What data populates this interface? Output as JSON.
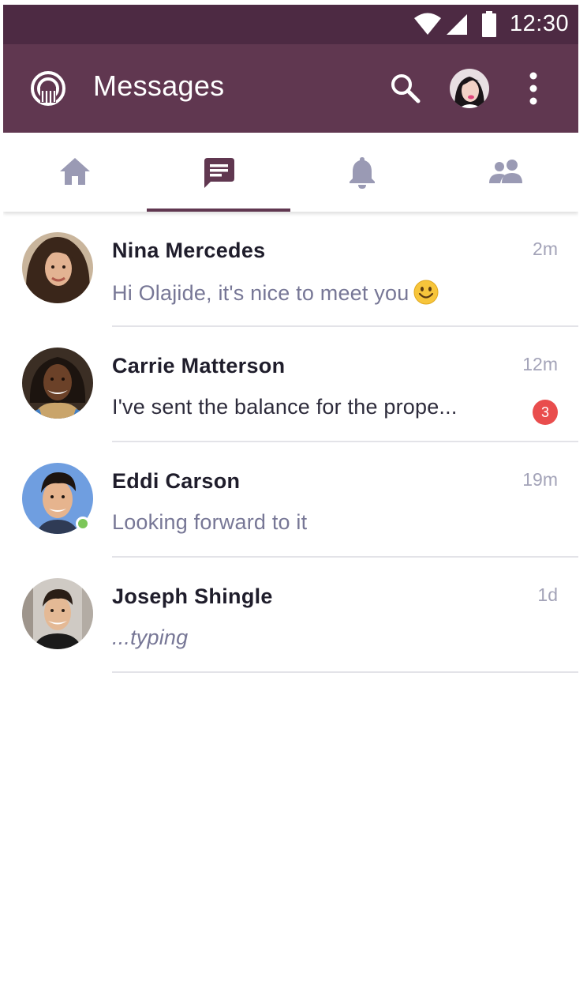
{
  "status_bar": {
    "time": "12:30",
    "icons": [
      "wifi-icon",
      "signal-icon",
      "battery-icon"
    ]
  },
  "app_bar": {
    "title": "Messages",
    "icons": [
      "app-logo",
      "search-icon",
      "profile-avatar",
      "more-vert-icon"
    ]
  },
  "tabs": [
    {
      "name": "home",
      "icon": "home-icon",
      "active": false
    },
    {
      "name": "messages",
      "icon": "chat-icon",
      "active": true
    },
    {
      "name": "notifications",
      "icon": "bell-icon",
      "active": false
    },
    {
      "name": "contacts",
      "icon": "people-icon",
      "active": false
    }
  ],
  "conversations": [
    {
      "name": "Nina Mercedes",
      "time": "2m",
      "preview": "Hi Olajide, it's nice to meet you",
      "emoji": "smiling-face",
      "online": false,
      "unread": null
    },
    {
      "name": "Carrie Matterson",
      "time": "12m",
      "preview": "I've sent the balance for  the prope...",
      "online": false,
      "unread": "3"
    },
    {
      "name": "Eddi Carson",
      "time": "19m",
      "preview": "Looking forward to it",
      "online": true,
      "unread": null
    },
    {
      "name": "Joseph Shingle",
      "time": "1d",
      "preview": "...typing",
      "online": false,
      "unread": null
    }
  ],
  "colors": {
    "status_bar": "#4d2a43",
    "app_bar": "#603750",
    "tab_active": "#603750",
    "tab_inactive": "#9a9ab4",
    "online": "#7cc659",
    "unread_badge": "#e94d4d"
  }
}
